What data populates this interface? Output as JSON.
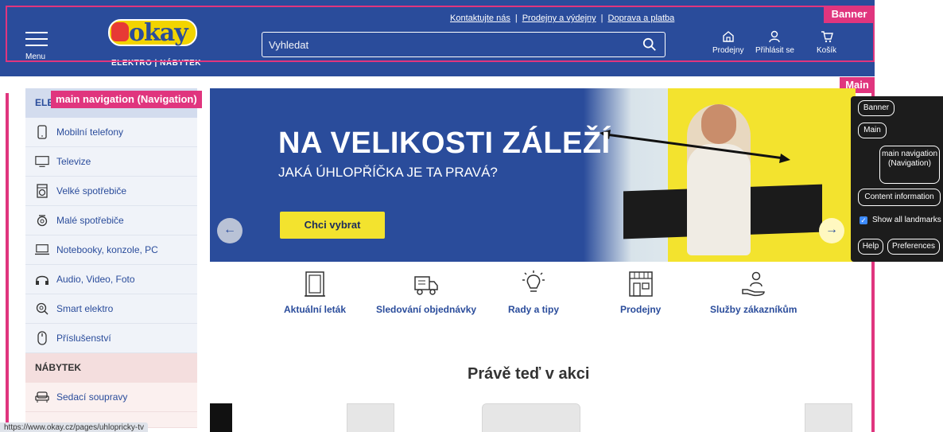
{
  "header": {
    "menu_label": "Menu",
    "logo_text": "okay",
    "logo_subtitle": "ELEKTRO | NÁBYTEK",
    "top_links": [
      "Kontaktujte nás",
      "Prodejny a výdejny",
      "Doprava a platba"
    ],
    "search_placeholder": "Vyhledat",
    "icons": [
      {
        "name": "store-icon",
        "label": "Prodejny"
      },
      {
        "name": "user-icon",
        "label": "Přihlásit se"
      },
      {
        "name": "cart-icon",
        "label": "Košík"
      }
    ]
  },
  "landmarks": {
    "banner_tag": "Banner",
    "main_tag": "Main",
    "nav_tag": "main navigation (Navigation)"
  },
  "sidebar": {
    "section1_head": "ELE",
    "items": [
      {
        "label": "Mobilní telefony",
        "icon": "phone-icon"
      },
      {
        "label": "Televize",
        "icon": "tv-icon"
      },
      {
        "label": "Velké spotřebiče",
        "icon": "washer-icon"
      },
      {
        "label": "Malé spotřebiče",
        "icon": "mixer-icon"
      },
      {
        "label": "Notebooky, konzole, PC",
        "icon": "laptop-icon"
      },
      {
        "label": "Audio, Video, Foto",
        "icon": "headphones-icon"
      },
      {
        "label": "Smart elektro",
        "icon": "smart-icon"
      },
      {
        "label": "Příslušenství",
        "icon": "mouse-icon"
      }
    ],
    "section2_head": "NÁBYTEK",
    "items2": [
      {
        "label": "Sedací soupravy",
        "icon": "sofa-icon"
      }
    ]
  },
  "hero": {
    "title": "NA VELIKOSTI ZÁLEŽÍ",
    "subtitle": "JAKÁ ÚHLOPŘÍČKA JE TA PRAVÁ?",
    "cta": "Chci vybrat",
    "prev_glyph": "←",
    "next_glyph": "→"
  },
  "quick_links": [
    {
      "label": "Aktuální leták",
      "icon": "leaflet-icon"
    },
    {
      "label": "Sledování objednávky",
      "icon": "delivery-truck-icon"
    },
    {
      "label": "Rady a tipy",
      "icon": "lightbulb-icon"
    },
    {
      "label": "Prodejny",
      "icon": "storefront-icon"
    },
    {
      "label": "Služby zákazníkům",
      "icon": "customer-service-icon"
    }
  ],
  "section_title": "Právě teď v akci",
  "status_url": "https://www.okay.cz/pages/uhlopricky-tv",
  "landmarks_panel": {
    "banner": "Banner",
    "main": "Main",
    "main_navigation": "main navigation (Navigation)",
    "content_information": "Content information",
    "show_all": "Show all landmarks",
    "help": "Help",
    "preferences": "Preferences"
  },
  "colors": {
    "brand_blue": "#2a4c9b",
    "brand_yellow": "#f3e32e",
    "landmark_pink": "#e0357e"
  }
}
